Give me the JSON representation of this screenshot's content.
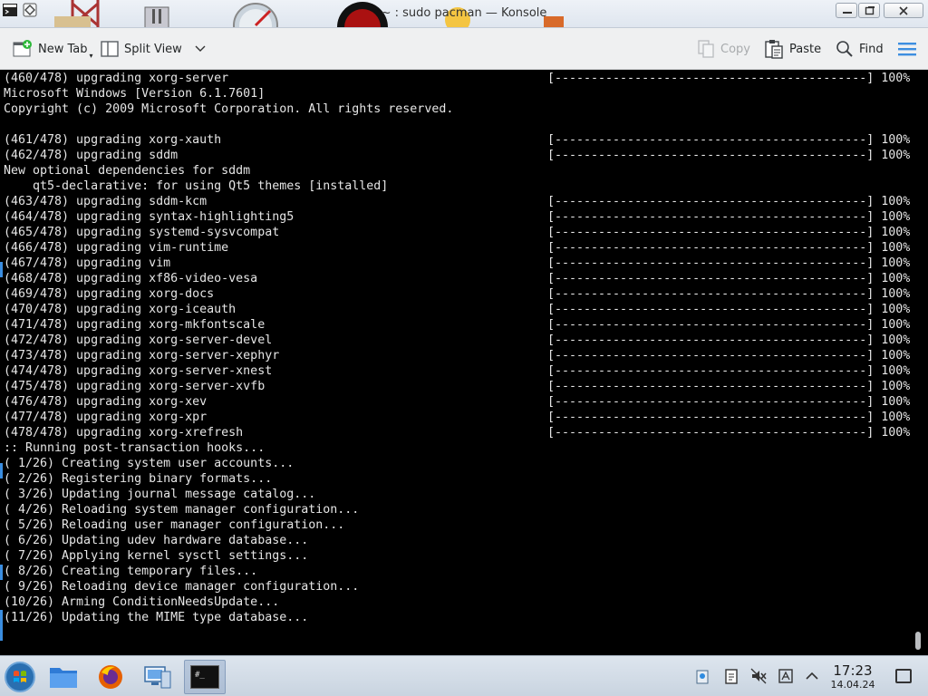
{
  "window": {
    "title": "~ : sudo pacman — Konsole"
  },
  "toolbar": {
    "new_tab": "New Tab",
    "split_view": "Split View",
    "copy": "Copy",
    "paste": "Paste",
    "find": "Find"
  },
  "terminal": {
    "lines": [
      {
        "text": "(460/478) upgrading xorg-server",
        "progress": "[-------------------------------------------] 100%"
      },
      {
        "text": "Microsoft Windows [Version 6.1.7601]",
        "progress": ""
      },
      {
        "text": "Copyright (c) 2009 Microsoft Corporation. All rights reserved.",
        "progress": ""
      },
      {
        "text": "",
        "progress": ""
      },
      {
        "text": "(461/478) upgrading xorg-xauth",
        "progress": "[-------------------------------------------] 100%"
      },
      {
        "text": "(462/478) upgrading sddm",
        "progress": "[-------------------------------------------] 100%"
      },
      {
        "text": "New optional dependencies for sddm",
        "progress": ""
      },
      {
        "text": "    qt5-declarative: for using Qt5 themes [installed]",
        "progress": ""
      },
      {
        "text": "(463/478) upgrading sddm-kcm",
        "progress": "[-------------------------------------------] 100%"
      },
      {
        "text": "(464/478) upgrading syntax-highlighting5",
        "progress": "[-------------------------------------------] 100%"
      },
      {
        "text": "(465/478) upgrading systemd-sysvcompat",
        "progress": "[-------------------------------------------] 100%"
      },
      {
        "text": "(466/478) upgrading vim-runtime",
        "progress": "[-------------------------------------------] 100%"
      },
      {
        "text": "(467/478) upgrading vim",
        "progress": "[-------------------------------------------] 100%"
      },
      {
        "text": "(468/478) upgrading xf86-video-vesa",
        "progress": "[-------------------------------------------] 100%"
      },
      {
        "text": "(469/478) upgrading xorg-docs",
        "progress": "[-------------------------------------------] 100%"
      },
      {
        "text": "(470/478) upgrading xorg-iceauth",
        "progress": "[-------------------------------------------] 100%"
      },
      {
        "text": "(471/478) upgrading xorg-mkfontscale",
        "progress": "[-------------------------------------------] 100%"
      },
      {
        "text": "(472/478) upgrading xorg-server-devel",
        "progress": "[-------------------------------------------] 100%"
      },
      {
        "text": "(473/478) upgrading xorg-server-xephyr",
        "progress": "[-------------------------------------------] 100%"
      },
      {
        "text": "(474/478) upgrading xorg-server-xnest",
        "progress": "[-------------------------------------------] 100%"
      },
      {
        "text": "(475/478) upgrading xorg-server-xvfb",
        "progress": "[-------------------------------------------] 100%"
      },
      {
        "text": "(476/478) upgrading xorg-xev",
        "progress": "[-------------------------------------------] 100%"
      },
      {
        "text": "(477/478) upgrading xorg-xpr",
        "progress": "[-------------------------------------------] 100%"
      },
      {
        "text": "(478/478) upgrading xorg-xrefresh",
        "progress": "[-------------------------------------------] 100%"
      },
      {
        "text": ":: Running post-transaction hooks...",
        "progress": ""
      },
      {
        "text": "( 1/26) Creating system user accounts...",
        "progress": ""
      },
      {
        "text": "( 2/26) Registering binary formats...",
        "progress": ""
      },
      {
        "text": "( 3/26) Updating journal message catalog...",
        "progress": ""
      },
      {
        "text": "( 4/26) Reloading system manager configuration...",
        "progress": ""
      },
      {
        "text": "( 5/26) Reloading user manager configuration...",
        "progress": ""
      },
      {
        "text": "( 6/26) Updating udev hardware database...",
        "progress": ""
      },
      {
        "text": "( 7/26) Applying kernel sysctl settings...",
        "progress": ""
      },
      {
        "text": "( 8/26) Creating temporary files...",
        "progress": ""
      },
      {
        "text": "( 9/26) Reloading device manager configuration...",
        "progress": ""
      },
      {
        "text": "(10/26) Arming ConditionNeedsUpdate...",
        "progress": ""
      },
      {
        "text": "(11/26) Updating the MIME type database...",
        "progress": ""
      }
    ]
  },
  "taskbar": {
    "time": "17:23",
    "date": "14.04.24",
    "terminal_icon_text": "#_"
  },
  "colors": {
    "terminal_bg": "#000000",
    "terminal_fg": "#e6e6e6",
    "accent": "#3a8de0"
  }
}
